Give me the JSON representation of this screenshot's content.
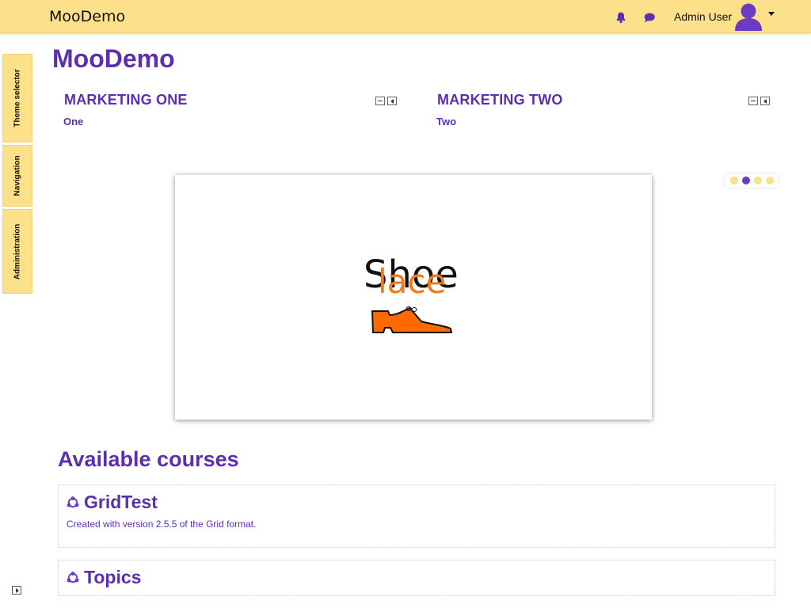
{
  "header": {
    "brand": "MooDemo",
    "user_name": "Admin User",
    "icons": [
      "bell-icon",
      "chat-icon",
      "user-avatar-icon",
      "caret-down-icon"
    ],
    "bar_color": "#fde08a"
  },
  "side_tabs": [
    {
      "label": "Theme selector"
    },
    {
      "label": "Navigation"
    },
    {
      "label": "Administration"
    }
  ],
  "page": {
    "title": "MooDemo",
    "accent_color": "#5b2fb0"
  },
  "marketing": [
    {
      "title": "MARKETING ONE",
      "text": "One"
    },
    {
      "title": "MARKETING TWO",
      "text": "Two"
    }
  ],
  "slider": {
    "logo_word_1": "Shoe",
    "logo_word_2": "lace",
    "logo_colors": {
      "word_1": "#111111",
      "word_2": "#f07a1a",
      "shoe": "#ff6a00"
    },
    "slide_count": 4,
    "active_slide": 2
  },
  "courses": {
    "heading": "Available courses",
    "items": [
      {
        "name": "GridTest",
        "summary": "Created with version 2.5.5 of the Grid format."
      },
      {
        "name": "Topics",
        "summary": ""
      }
    ]
  }
}
